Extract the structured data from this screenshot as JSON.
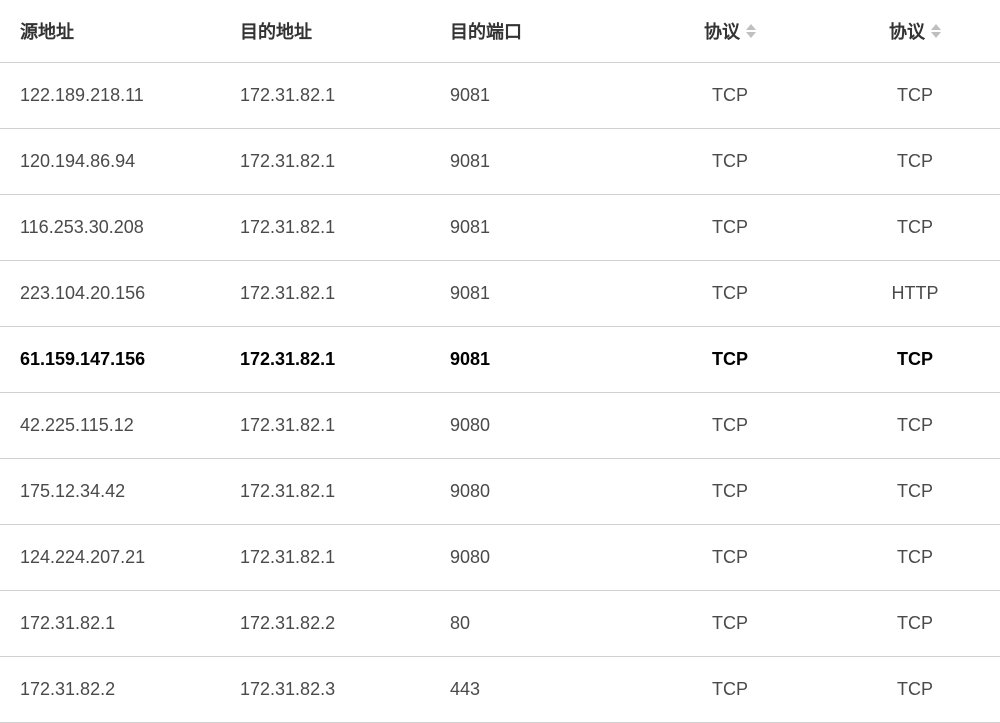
{
  "table": {
    "headers": {
      "source_addr": "源地址",
      "dest_addr": "目的地址",
      "dest_port": "目的端口",
      "protocol1": "协议",
      "protocol2": "协议"
    },
    "rows": [
      {
        "source_addr": "122.189.218.11",
        "dest_addr": "172.31.82.1",
        "dest_port": "9081",
        "protocol1": "TCP",
        "protocol2": "TCP",
        "bold": false
      },
      {
        "source_addr": "120.194.86.94",
        "dest_addr": "172.31.82.1",
        "dest_port": "9081",
        "protocol1": "TCP",
        "protocol2": "TCP",
        "bold": false
      },
      {
        "source_addr": "116.253.30.208",
        "dest_addr": "172.31.82.1",
        "dest_port": "9081",
        "protocol1": "TCP",
        "protocol2": "TCP",
        "bold": false
      },
      {
        "source_addr": "223.104.20.156",
        "dest_addr": "172.31.82.1",
        "dest_port": "9081",
        "protocol1": "TCP",
        "protocol2": "HTTP",
        "bold": false
      },
      {
        "source_addr": "61.159.147.156",
        "dest_addr": "172.31.82.1",
        "dest_port": "9081",
        "protocol1": "TCP",
        "protocol2": "TCP",
        "bold": true
      },
      {
        "source_addr": "42.225.115.12",
        "dest_addr": "172.31.82.1",
        "dest_port": "9080",
        "protocol1": "TCP",
        "protocol2": "TCP",
        "bold": false
      },
      {
        "source_addr": "175.12.34.42",
        "dest_addr": "172.31.82.1",
        "dest_port": "9080",
        "protocol1": "TCP",
        "protocol2": "TCP",
        "bold": false
      },
      {
        "source_addr": "124.224.207.21",
        "dest_addr": "172.31.82.1",
        "dest_port": "9080",
        "protocol1": "TCP",
        "protocol2": "TCP",
        "bold": false
      },
      {
        "source_addr": "172.31.82.1",
        "dest_addr": "172.31.82.2",
        "dest_port": "80",
        "protocol1": "TCP",
        "protocol2": "TCP",
        "bold": false
      },
      {
        "source_addr": "172.31.82.2",
        "dest_addr": "172.31.82.3",
        "dest_port": "443",
        "protocol1": "TCP",
        "protocol2": "TCP",
        "bold": false
      }
    ]
  }
}
